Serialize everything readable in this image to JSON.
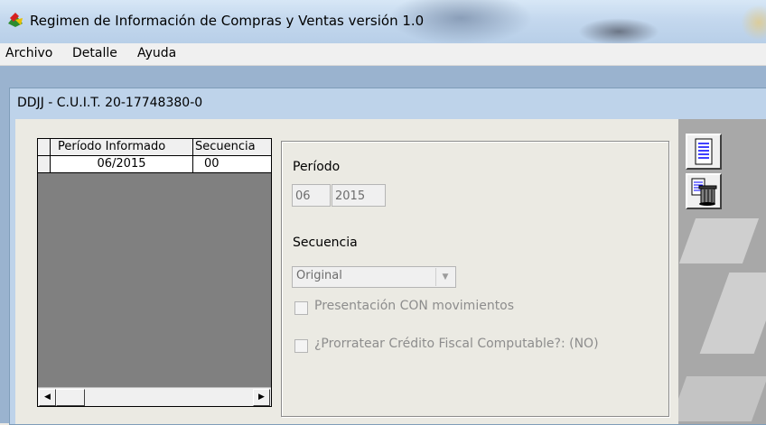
{
  "window": {
    "title": "Regimen de Información de Compras y Ventas versión 1.0"
  },
  "menu": {
    "items": [
      "Archivo",
      "Detalle",
      "Ayuda"
    ]
  },
  "child": {
    "title": "DDJJ - C.U.I.T. 20-17748380-0"
  },
  "grid": {
    "columns": [
      "Período Informado",
      "Secuencia"
    ],
    "rows": [
      {
        "periodo": "06/2015",
        "secuencia": "00"
      }
    ]
  },
  "form": {
    "periodo_label": "Período",
    "periodo_mes": "06",
    "periodo_anio": "2015",
    "secuencia_label": "Secuencia",
    "secuencia_value": "Original",
    "check_movimientos": "Presentación CON movimientos",
    "check_prorratear": "¿Prorratear Crédito Fiscal Computable?: (NO)"
  },
  "toolbar": {
    "icons": [
      "document-list-icon",
      "delete-trash-icon"
    ]
  },
  "colors": {
    "titlebar": "#c4d8ee",
    "mdi": "#9ab3cf",
    "child_frame": "#bed3ea",
    "grid_bg": "#808080"
  }
}
